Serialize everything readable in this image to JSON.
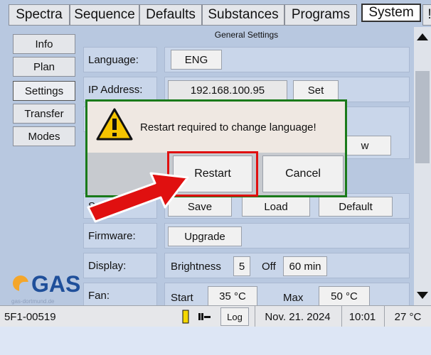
{
  "tabs": [
    "Spectra",
    "Sequence",
    "Defaults",
    "Substances",
    "Programs",
    "System",
    "!"
  ],
  "side_menu": [
    "Info",
    "Plan",
    "Settings",
    "Transfer",
    "Modes"
  ],
  "logo": {
    "text": "GAS",
    "subtext": "gas-dortmund.de"
  },
  "section_title": "General Settings",
  "rows": {
    "language": {
      "label": "Language:",
      "value": "ENG"
    },
    "ip": {
      "label": "IP Address:",
      "value": "192.168.100.95",
      "button": "Set"
    },
    "settings": {
      "label": "Settings:",
      "save": "Save",
      "load": "Load",
      "default": "Default"
    },
    "firmware": {
      "label": "Firmware:",
      "upgrade": "Upgrade"
    },
    "display": {
      "label": "Display:",
      "brightness_label": "Brightness",
      "brightness_value": "5",
      "off_label": "Off",
      "off_value": "60 min"
    },
    "fan": {
      "label": "Fan:",
      "start_label": "Start",
      "start_value": "35 °C",
      "max_label": "Max",
      "max_value": "50 °C"
    },
    "hidden_button_fragment": "w"
  },
  "dialog": {
    "message": "Restart required to change language!",
    "restart": "Restart",
    "cancel": "Cancel"
  },
  "status": {
    "device_id": "5F1-00519",
    "log": "Log",
    "date": "Nov. 21. 2024",
    "time": "10:01",
    "temperature": "27 °C"
  },
  "colors": {
    "dialog_border": "#1a7a1a",
    "highlight": "#e01010",
    "arrow": "#e01010",
    "logo_blue": "#1f4f9a",
    "logo_orange": "#f4a62a"
  }
}
